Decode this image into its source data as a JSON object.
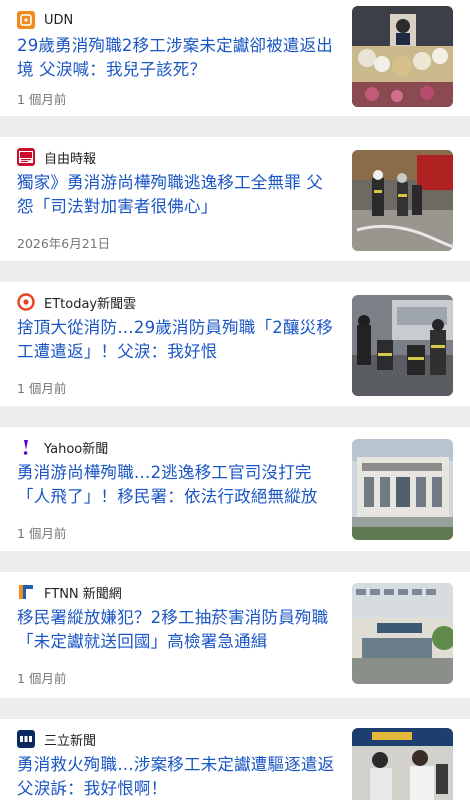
{
  "articles": [
    {
      "source": "UDN",
      "title": "29歲勇消殉職2移工涉案未定讞卻被遣返出境 父淚喊：我兒子該死？",
      "time": "1 個月前",
      "logo_icon": "udn-logo-icon",
      "logo_color": "#f08a1c",
      "thumbnail": "memorial-altar-image"
    },
    {
      "source": "自由時報",
      "title": "獨家》勇消游尚樺殉職逃逸移工全無罪 父怨「司法對加害者很佛心」",
      "time": "2026年6月21日",
      "logo_icon": "ltn-logo-icon",
      "logo_color": "#c8102e",
      "thumbnail": "firefighters-scene-image"
    },
    {
      "source": "ETtoday新聞雲",
      "title": "捨頂大從消防…29歲消防員殉職「2釀災移工遭遣返」！父淚：我好恨",
      "time": "1 個月前",
      "logo_icon": "ettoday-logo-icon",
      "logo_color": "#e8411f",
      "thumbnail": "firefighters-rescue-image"
    },
    {
      "source": "Yahoo新聞",
      "title": "勇消游尚樺殉職…2逃逸移工官司沒打完「人飛了」！移民署：依法行政絕無縱放",
      "time": "1 個月前",
      "logo_icon": "yahoo-logo-icon",
      "logo_color": "#6001d2",
      "thumbnail": "courthouse-building-image"
    },
    {
      "source": "FTNN 新聞網",
      "title": "移民署縱放嫌犯？2移工抽菸害消防員殉職「未定讞就送回國」高檢署急通緝",
      "time": "1 個月前",
      "logo_icon": "ftnn-logo-icon",
      "logo_color": "#1f5fb3",
      "thumbnail": "prosecutors-office-image"
    },
    {
      "source": "三立新聞",
      "title": "勇消救火殉職…涉案移工未定讞遭驅逐遣返 父淚訴：我好恨啊！",
      "time": "",
      "logo_icon": "set-logo-icon",
      "logo_color": "#0a2a5e",
      "thumbnail": "airport-people-image"
    }
  ]
}
